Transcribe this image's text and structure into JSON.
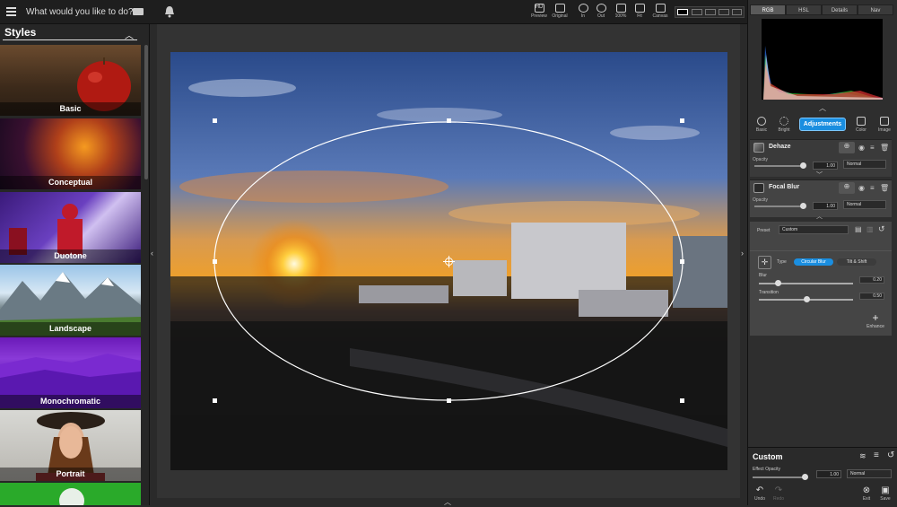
{
  "search": {
    "placeholder": "What would you like to do?"
  },
  "styles": {
    "title": "Styles",
    "items": [
      {
        "label": "Basic"
      },
      {
        "label": "Conceptual"
      },
      {
        "label": "Duotone"
      },
      {
        "label": "Landscape"
      },
      {
        "label": "Monochromatic"
      },
      {
        "label": "Portrait"
      }
    ]
  },
  "toolbar": {
    "preview": "Preview",
    "original": "Original",
    "zoom_in": "In",
    "zoom_out": "Out",
    "zoom_100": "100%",
    "fit": "Fit",
    "canvas": "Canvas",
    "hd": "HD"
  },
  "histogram_tabs": [
    "RGB",
    "HSL",
    "Details",
    "Nav"
  ],
  "adjust_tabs": {
    "basic": "Basic",
    "bright": "Bright",
    "adjustments": "Adjustments",
    "color": "Color",
    "image": "Image"
  },
  "layers": [
    {
      "name": "Dehaze",
      "opacity_label": "Opacity",
      "opacity": "1.00",
      "mode": "Normal"
    },
    {
      "name": "Focal Blur",
      "opacity_label": "Opacity",
      "opacity": "1.00",
      "mode": "Normal"
    }
  ],
  "focal": {
    "preset_label": "Preset",
    "preset_value": "Custom",
    "type_label": "Type",
    "type_active": "Circular Blur",
    "type_other": "Tilt & Shift",
    "blur_label": "Blur",
    "blur_value": "0.20",
    "blur_fraction": 0.2,
    "transition_label": "Transition",
    "transition_value": "0.50",
    "transition_fraction": 0.5,
    "enhance": "Enhance"
  },
  "bottom": {
    "title": "Custom",
    "effect_opacity_label": "Effect Opacity",
    "effect_opacity": "1.00",
    "mode": "Normal",
    "undo": "Undo",
    "redo": "Redo",
    "exit": "Exit",
    "save": "Save"
  },
  "colors": {
    "accent": "#1a8ee0"
  }
}
